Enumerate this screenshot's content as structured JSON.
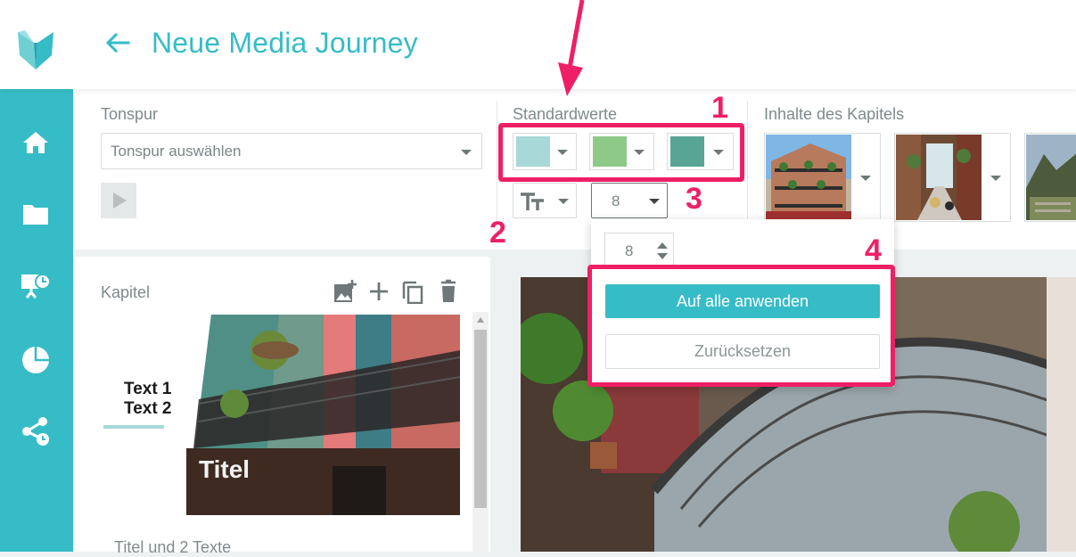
{
  "header": {
    "title": "Neue Media Journey"
  },
  "sidebar": {
    "items": [
      "home-icon",
      "folder-icon",
      "presentation-schedule-icon",
      "pie-chart-icon",
      "share-schedule-icon"
    ]
  },
  "toolbar": {
    "tonspur": {
      "label": "Tonspur",
      "placeholder": "Tonspur auswählen"
    },
    "standardwerte": {
      "label": "Standardwerte",
      "colors": [
        "#a8d8d8",
        "#8fc987",
        "#58a595"
      ],
      "font_size": "8"
    },
    "inhalte": {
      "label": "Inhalte des Kapitels"
    }
  },
  "dropdown": {
    "number_value": "8",
    "apply_label": "Auf alle anwenden",
    "reset_label": "Zurücksetzen"
  },
  "chapter": {
    "label": "Kapitel",
    "thumb_text1": "Text 1",
    "thumb_text2": "Text 2",
    "thumb_title": "Titel",
    "caption": "Titel und 2 Texte"
  },
  "annotations": {
    "n1": "1",
    "n2": "2",
    "n3": "3",
    "n4": "4",
    "color": "#ee1f66"
  },
  "colors": {
    "accent": "#36bcc6"
  }
}
